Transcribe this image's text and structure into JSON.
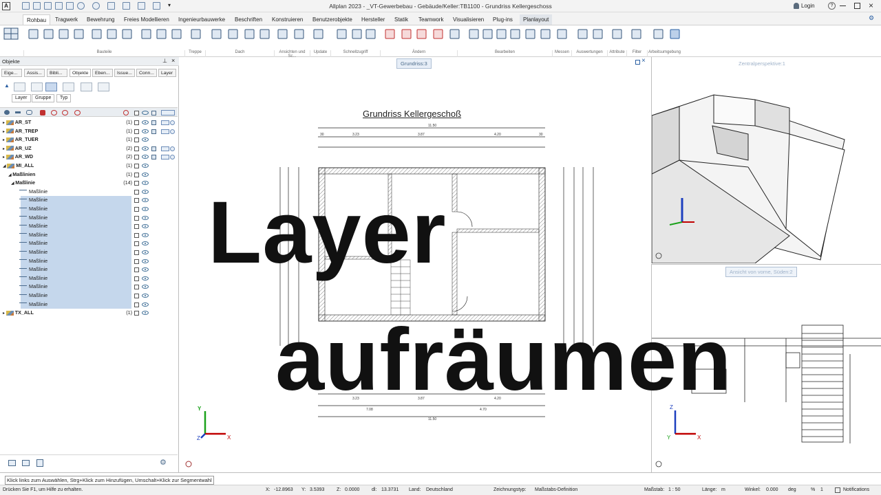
{
  "window": {
    "title": "Allplan 2023 - _VT-Gewerbebau - Gebäude/Keller:TB1100 - Grundriss Kellergeschoss",
    "login": "Login"
  },
  "ribbon_tabs": [
    "Rohbau",
    "Tragwerk",
    "Bewehrung",
    "Freies Modellieren",
    "Ingenieurbauwerke",
    "Beschriften",
    "Konstruieren",
    "Benutzerobjekte",
    "Hersteller",
    "Statik",
    "Teamwork",
    "Visualisieren",
    "Plug-ins",
    "Planlayout"
  ],
  "ribbon_groups": [
    "Bauteile",
    "Treppe",
    "Dach",
    "Ansichten und Sc...",
    "Update",
    "Schnellzugriff",
    "Ändern",
    "Bearbeiten",
    "Messen",
    "Auswertungen",
    "Attribute",
    "Filter",
    "Arbeitsumgebung"
  ],
  "left_panel": {
    "title": "Objekte",
    "tabs": [
      "Eige...",
      "Assis...",
      "Bibli...",
      "Objekte",
      "Eben...",
      "Issue...",
      "Conn...",
      "Layer"
    ],
    "filters": [
      "Layer",
      "Gruppe",
      "Typ"
    ],
    "rows": [
      {
        "label": "AR_ST",
        "count": "(1)",
        "level": 0,
        "type": "layer",
        "ext": true
      },
      {
        "label": "AR_TREP",
        "count": "(1)",
        "level": 0,
        "type": "layer",
        "ext": true
      },
      {
        "label": "AR_TUER",
        "count": "(1)",
        "level": 0,
        "type": "layer",
        "ext": false
      },
      {
        "label": "AR_UZ",
        "count": "(2)",
        "level": 0,
        "type": "layer",
        "ext": true
      },
      {
        "label": "AR_WD",
        "count": "(2)",
        "level": 0,
        "type": "layer",
        "ext": true
      },
      {
        "label": "MI_ALL",
        "count": "(1)",
        "level": 0,
        "type": "layer",
        "ext": false
      },
      {
        "label": "Maßlinien",
        "count": "(1)",
        "level": 1,
        "type": "group",
        "ext": false
      },
      {
        "label": "Maßlinie",
        "count": "(14)",
        "level": 2,
        "type": "group",
        "ext": false
      },
      {
        "label": "Maßlinie",
        "count": "",
        "level": 3,
        "type": "item",
        "hl": false
      },
      {
        "label": "Maßlinie",
        "count": "",
        "level": 3,
        "type": "item",
        "hl": true
      },
      {
        "label": "Maßlinie",
        "count": "",
        "level": 3,
        "type": "item",
        "hl": true
      },
      {
        "label": "Maßlinie",
        "count": "",
        "level": 3,
        "type": "item",
        "hl": true
      },
      {
        "label": "Maßlinie",
        "count": "",
        "level": 3,
        "type": "item",
        "hl": true
      },
      {
        "label": "Maßlinie",
        "count": "",
        "level": 3,
        "type": "item",
        "hl": true
      },
      {
        "label": "Maßlinie",
        "count": "",
        "level": 3,
        "type": "item",
        "hl": true
      },
      {
        "label": "Maßlinie",
        "count": "",
        "level": 3,
        "type": "item",
        "hl": true
      },
      {
        "label": "Maßlinie",
        "count": "",
        "level": 3,
        "type": "item",
        "hl": true
      },
      {
        "label": "Maßlinie",
        "count": "",
        "level": 3,
        "type": "item",
        "hl": true
      },
      {
        "label": "Maßlinie",
        "count": "",
        "level": 3,
        "type": "item",
        "hl": true
      },
      {
        "label": "Maßlinie",
        "count": "",
        "level": 3,
        "type": "item",
        "hl": true
      },
      {
        "label": "Maßlinie",
        "count": "",
        "level": 3,
        "type": "item",
        "hl": true
      },
      {
        "label": "Maßlinie",
        "count": "",
        "level": 3,
        "type": "item",
        "hl": true
      },
      {
        "label": "TX_ALL",
        "count": "(1)",
        "level": 0,
        "type": "layer",
        "ext": false
      }
    ]
  },
  "views": {
    "plan_label": "Grundriss:3",
    "plan_title": "Grundriss Kellergeschoß",
    "persp_label": "Zentralperspektive:1",
    "front_label": "Ansicht von vorne, Süden:2"
  },
  "overlay": {
    "line1": "Layer",
    "line2": "aufräumen"
  },
  "status": {
    "hint": "Klick links zum Auswählen, Strg+Klick zum Hinzufügen, Umschalt+Klick zur Segmentwahl",
    "help": "Drücken Sie F1, um Hilfe zu erhalten.",
    "x_label": "X:",
    "x": "-12.8963",
    "y_label": "Y:",
    "y": "3.5393",
    "z_label": "Z:",
    "z": "0.0000",
    "dl_label": "dl:",
    "dl": "13.3731",
    "land_label": "Land:",
    "land": "Deutschland",
    "zt_label": "Zeichnungstyp:",
    "zt": "Maßstabs-Definition",
    "scale_label": "Maßstab:",
    "scale": "1 : 50",
    "len_label": "Länge:",
    "len": "m",
    "angle_label": "Winkel:",
    "angle": "0.000",
    "deg": "deg",
    "pct": "%",
    "pct_val": "1",
    "notifications": "Notifications"
  },
  "dims": {
    "total": "11.50",
    "d1": "3.23",
    "d2": "3.87",
    "d3": "4.20",
    "e1": "30",
    "e2": "30",
    "b1": "7.08",
    "b2": "4.70"
  },
  "colors": {
    "accent": "#2a5fa3",
    "highlight": "#c5d7ec",
    "axis_x": "#c00000",
    "axis_y": "#1aa11a",
    "axis_z": "#1c3fbf"
  }
}
